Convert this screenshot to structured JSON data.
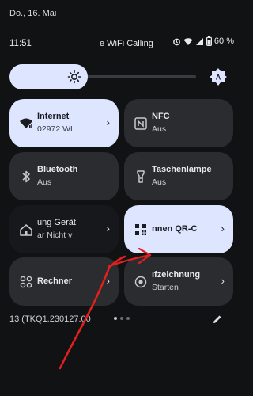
{
  "status_bar": {
    "date": "Do., 16. Mai",
    "time": "11:51",
    "carrier": "e WiFi Calling",
    "battery": "60 %"
  },
  "brightness": {
    "level": 0.42
  },
  "tiles": {
    "internet": {
      "title": "Internet",
      "subtitle": "02972     WL",
      "chevron": "›"
    },
    "nfc": {
      "title": "NFC",
      "subtitle": "Aus"
    },
    "bluetooth": {
      "title": "Bluetooth",
      "subtitle": "Aus"
    },
    "flashlight": {
      "title": "Taschenlampe",
      "subtitle": "Aus"
    },
    "devices": {
      "title": "ung      Gerät",
      "subtitle": "ar      Nicht v",
      "chevron": "›"
    },
    "qr": {
      "title": "nnen      QR-C",
      "chevron": "›"
    },
    "calculator": {
      "title": "Rechner",
      "chevron": "›"
    },
    "screen_record": {
      "title": "ıfzeichnung",
      "subtitle": "Starten",
      "chevron": "›"
    }
  },
  "footer": {
    "build": "13 (TKQ1.230127.00"
  },
  "colors": {
    "accent": "#dde5ff",
    "tile_off": "#2b2c30",
    "annotation": "#e0201d"
  }
}
